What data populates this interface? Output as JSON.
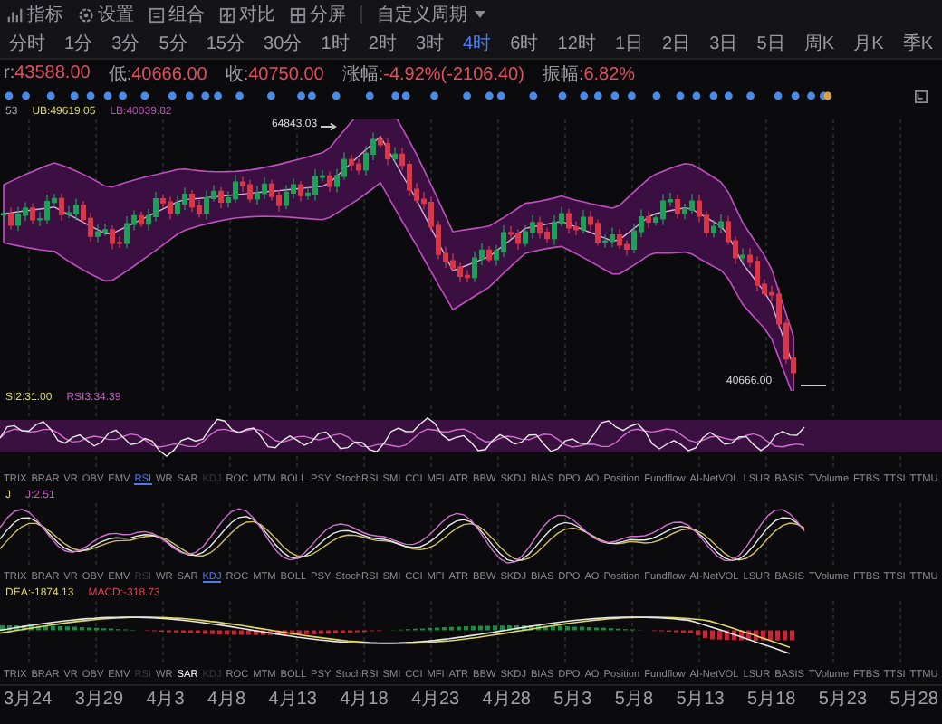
{
  "toolbar": {
    "tools": [
      {
        "label": "指标"
      },
      {
        "label": "设置"
      },
      {
        "label": "组合"
      },
      {
        "label": "对比"
      },
      {
        "label": "分屏"
      }
    ],
    "period_menu": {
      "label": "自定义周期"
    },
    "periods": [
      {
        "label": "分时",
        "selected": false
      },
      {
        "label": "1分",
        "selected": false
      },
      {
        "label": "3分",
        "selected": false
      },
      {
        "label": "5分",
        "selected": false
      },
      {
        "label": "15分",
        "selected": false
      },
      {
        "label": "30分",
        "selected": false
      },
      {
        "label": "1时",
        "selected": false
      },
      {
        "label": "2时",
        "selected": false
      },
      {
        "label": "3时",
        "selected": false
      },
      {
        "label": "4时",
        "selected": true
      },
      {
        "label": "6时",
        "selected": false
      },
      {
        "label": "12时",
        "selected": false
      },
      {
        "label": "1日",
        "selected": false
      },
      {
        "label": "2日",
        "selected": false
      },
      {
        "label": "3日",
        "selected": false
      },
      {
        "label": "5日",
        "selected": false
      },
      {
        "label": "周K",
        "selected": false
      },
      {
        "label": "月K",
        "selected": false
      },
      {
        "label": "季K",
        "selected": false
      }
    ]
  },
  "quote": [
    {
      "label": "r:",
      "value": "43588.00"
    },
    {
      "label": "低:",
      "value": "40666.00"
    },
    {
      "label": "收:",
      "value": "40750.00"
    },
    {
      "label": "涨幅:",
      "value": "-4.92%(-2106.40)"
    },
    {
      "label": "振幅:",
      "value": "6.82%"
    }
  ],
  "main_chart": {
    "legend": [
      {
        "text": "53",
        "color": "#a0a0a8"
      },
      {
        "text": "UB:49619.05",
        "color": "#e0d860"
      },
      {
        "text": "LB:40039.82",
        "color": "#c050c0"
      }
    ],
    "price_labels": [
      {
        "text": "64843.03",
        "kind": "high"
      },
      {
        "text": "40666.00",
        "kind": "low"
      }
    ]
  },
  "panels": [
    {
      "kind": "rsi",
      "legend": [
        {
          "text": "SI2:31.00",
          "color": "#e0d860"
        },
        {
          "text": "RSI3:34.39",
          "color": "#c060c0"
        }
      ],
      "tabs": [
        {
          "label": "TRIX",
          "selected": false,
          "disabled": false
        },
        {
          "label": "BRAR",
          "selected": false,
          "disabled": false
        },
        {
          "label": "VR",
          "selected": false,
          "disabled": false
        },
        {
          "label": "OBV",
          "selected": false,
          "disabled": false
        },
        {
          "label": "EMV",
          "selected": false,
          "disabled": false
        },
        {
          "label": "RSI",
          "selected": true,
          "disabled": false
        },
        {
          "label": "WR",
          "selected": false,
          "disabled": false
        },
        {
          "label": "SAR",
          "selected": false,
          "disabled": false
        },
        {
          "label": "KDJ",
          "selected": false,
          "disabled": true
        },
        {
          "label": "ROC",
          "selected": false,
          "disabled": false
        },
        {
          "label": "MTM",
          "selected": false,
          "disabled": false
        },
        {
          "label": "BOLL",
          "selected": false,
          "disabled": false
        },
        {
          "label": "PSY",
          "selected": false,
          "disabled": false
        },
        {
          "label": "StochRSI",
          "selected": false,
          "disabled": false
        },
        {
          "label": "SMI",
          "selected": false,
          "disabled": false
        },
        {
          "label": "CCI",
          "selected": false,
          "disabled": false
        },
        {
          "label": "MFI",
          "selected": false,
          "disabled": false
        },
        {
          "label": "ATR",
          "selected": false,
          "disabled": false
        },
        {
          "label": "BBW",
          "selected": false,
          "disabled": false
        },
        {
          "label": "SKDJ",
          "selected": false,
          "disabled": false
        },
        {
          "label": "BIAS",
          "selected": false,
          "disabled": false
        },
        {
          "label": "DPO",
          "selected": false,
          "disabled": false
        },
        {
          "label": "AO",
          "selected": false,
          "disabled": false
        },
        {
          "label": "Position",
          "selected": false,
          "disabled": false
        },
        {
          "label": "Fundflow",
          "selected": false,
          "disabled": false
        },
        {
          "label": "AI-NetVOL",
          "selected": false,
          "disabled": false
        },
        {
          "label": "LSUR",
          "selected": false,
          "disabled": false
        },
        {
          "label": "BASIS",
          "selected": false,
          "disabled": false
        },
        {
          "label": "TVolume",
          "selected": false,
          "disabled": false
        },
        {
          "label": "FTBS",
          "selected": false,
          "disabled": false
        },
        {
          "label": "TTSI",
          "selected": false,
          "disabled": false
        },
        {
          "label": "TTMU",
          "selected": false,
          "disabled": false
        }
      ]
    },
    {
      "kind": "kdj",
      "legend": [
        {
          "text": "J",
          "color": "#e0d860"
        },
        {
          "text": "J:2.51",
          "color": "#c060c0"
        }
      ],
      "tabs": [
        {
          "label": "TRIX",
          "selected": false,
          "disabled": false
        },
        {
          "label": "BRAR",
          "selected": false,
          "disabled": false
        },
        {
          "label": "VR",
          "selected": false,
          "disabled": false
        },
        {
          "label": "OBV",
          "selected": false,
          "disabled": false
        },
        {
          "label": "EMV",
          "selected": false,
          "disabled": false
        },
        {
          "label": "RSI",
          "selected": false,
          "disabled": true
        },
        {
          "label": "WR",
          "selected": false,
          "disabled": false
        },
        {
          "label": "SAR",
          "selected": false,
          "disabled": false
        },
        {
          "label": "KDJ",
          "selected": true,
          "disabled": false
        },
        {
          "label": "ROC",
          "selected": false,
          "disabled": false
        },
        {
          "label": "MTM",
          "selected": false,
          "disabled": false
        },
        {
          "label": "BOLL",
          "selected": false,
          "disabled": false
        },
        {
          "label": "PSY",
          "selected": false,
          "disabled": false
        },
        {
          "label": "StochRSI",
          "selected": false,
          "disabled": false
        },
        {
          "label": "SMI",
          "selected": false,
          "disabled": false
        },
        {
          "label": "CCI",
          "selected": false,
          "disabled": false
        },
        {
          "label": "MFI",
          "selected": false,
          "disabled": false
        },
        {
          "label": "ATR",
          "selected": false,
          "disabled": false
        },
        {
          "label": "BBW",
          "selected": false,
          "disabled": false
        },
        {
          "label": "SKDJ",
          "selected": false,
          "disabled": false
        },
        {
          "label": "BIAS",
          "selected": false,
          "disabled": false
        },
        {
          "label": "DPO",
          "selected": false,
          "disabled": false
        },
        {
          "label": "AO",
          "selected": false,
          "disabled": false
        },
        {
          "label": "Position",
          "selected": false,
          "disabled": false
        },
        {
          "label": "Fundflow",
          "selected": false,
          "disabled": false
        },
        {
          "label": "AI-NetVOL",
          "selected": false,
          "disabled": false
        },
        {
          "label": "LSUR",
          "selected": false,
          "disabled": false
        },
        {
          "label": "BASIS",
          "selected": false,
          "disabled": false
        },
        {
          "label": "TVolume",
          "selected": false,
          "disabled": false
        },
        {
          "label": "FTBS",
          "selected": false,
          "disabled": false
        },
        {
          "label": "TTSI",
          "selected": false,
          "disabled": false
        },
        {
          "label": "TTMU",
          "selected": false,
          "disabled": false
        }
      ]
    },
    {
      "kind": "macd",
      "legend": [
        {
          "text": "DEA:-1874.13",
          "color": "#e0d860"
        },
        {
          "text": "MACD:-318.73",
          "color": "#e04050"
        }
      ],
      "tabs": [
        {
          "label": "TRIX",
          "selected": false,
          "disabled": false,
          "hovered": false
        },
        {
          "label": "BRAR",
          "selected": false,
          "disabled": false,
          "hovered": false
        },
        {
          "label": "VR",
          "selected": false,
          "disabled": false,
          "hovered": false
        },
        {
          "label": "OBV",
          "selected": false,
          "disabled": false,
          "hovered": false
        },
        {
          "label": "EMV",
          "selected": false,
          "disabled": false,
          "hovered": false
        },
        {
          "label": "RSI",
          "selected": false,
          "disabled": true,
          "hovered": false
        },
        {
          "label": "WR",
          "selected": false,
          "disabled": false,
          "hovered": false
        },
        {
          "label": "SAR",
          "selected": false,
          "disabled": false,
          "hovered": true
        },
        {
          "label": "KDJ",
          "selected": false,
          "disabled": true,
          "hovered": false
        },
        {
          "label": "ROC",
          "selected": false,
          "disabled": false,
          "hovered": false
        },
        {
          "label": "MTM",
          "selected": false,
          "disabled": false,
          "hovered": false
        },
        {
          "label": "BOLL",
          "selected": false,
          "disabled": false,
          "hovered": false
        },
        {
          "label": "PSY",
          "selected": false,
          "disabled": false,
          "hovered": false
        },
        {
          "label": "StochRSI",
          "selected": false,
          "disabled": false,
          "hovered": false
        },
        {
          "label": "SMI",
          "selected": false,
          "disabled": false,
          "hovered": false
        },
        {
          "label": "CCI",
          "selected": false,
          "disabled": false,
          "hovered": false
        },
        {
          "label": "MFI",
          "selected": false,
          "disabled": false,
          "hovered": false
        },
        {
          "label": "ATR",
          "selected": false,
          "disabled": false,
          "hovered": false
        },
        {
          "label": "BBW",
          "selected": false,
          "disabled": false,
          "hovered": false
        },
        {
          "label": "SKDJ",
          "selected": false,
          "disabled": false,
          "hovered": false
        },
        {
          "label": "BIAS",
          "selected": false,
          "disabled": false,
          "hovered": false
        },
        {
          "label": "DPO",
          "selected": false,
          "disabled": false,
          "hovered": false
        },
        {
          "label": "AO",
          "selected": false,
          "disabled": false,
          "hovered": false
        },
        {
          "label": "Position",
          "selected": false,
          "disabled": false,
          "hovered": false
        },
        {
          "label": "Fundflow",
          "selected": false,
          "disabled": false,
          "hovered": false
        },
        {
          "label": "AI-NetVOL",
          "selected": false,
          "disabled": false,
          "hovered": false
        },
        {
          "label": "LSUR",
          "selected": false,
          "disabled": false,
          "hovered": false
        },
        {
          "label": "BASIS",
          "selected": false,
          "disabled": false,
          "hovered": false
        },
        {
          "label": "TVolume",
          "selected": false,
          "disabled": false,
          "hovered": false
        },
        {
          "label": "FTBS",
          "selected": false,
          "disabled": false,
          "hovered": false
        },
        {
          "label": "TTSI",
          "selected": false,
          "disabled": false,
          "hovered": false
        },
        {
          "label": "TTMU",
          "selected": false,
          "disabled": false,
          "hovered": false
        }
      ]
    }
  ],
  "date_axis": [
    "3月24",
    "3月29",
    "4月3",
    "4月8",
    "4月13",
    "4月18",
    "4月23",
    "4月28",
    "5月3",
    "5月8",
    "5月13",
    "5月18",
    "5月23",
    "5月28"
  ]
}
